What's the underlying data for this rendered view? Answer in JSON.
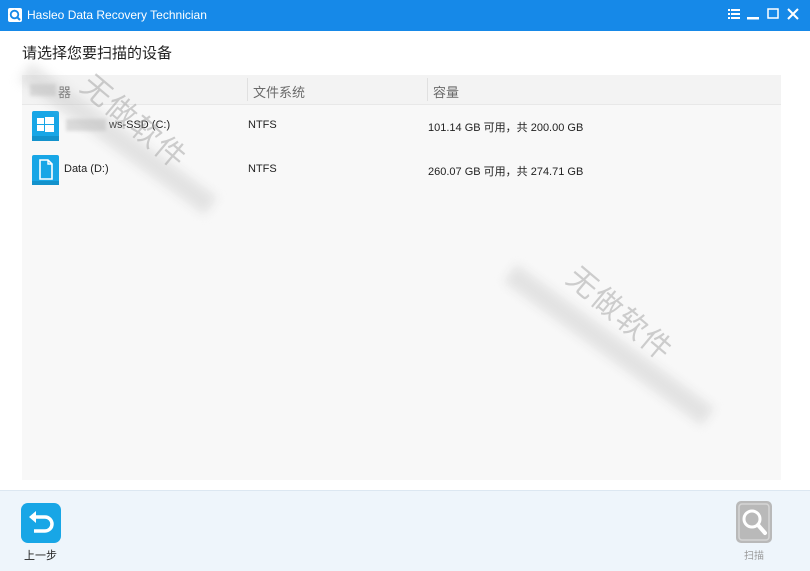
{
  "window": {
    "title": "Hasleo Data Recovery Technician",
    "accent": "#1689e8"
  },
  "prompt": "请选择您要扫描的设备",
  "table": {
    "columns": [
      "器",
      "文件系统",
      "容量"
    ],
    "rows": [
      {
        "icon": "windows-drive-icon",
        "name": "ws-SSD (C:)",
        "filesystem": "NTFS",
        "capacity": "101.14 GB 可用，共 200.00 GB"
      },
      {
        "icon": "data-drive-icon",
        "name": "Data (D:)",
        "filesystem": "NTFS",
        "capacity": "260.07 GB 可用，共 274.71 GB"
      }
    ]
  },
  "footer": {
    "back_label": "上一步",
    "scan_label": "扫描"
  },
  "watermark": "无做软件"
}
